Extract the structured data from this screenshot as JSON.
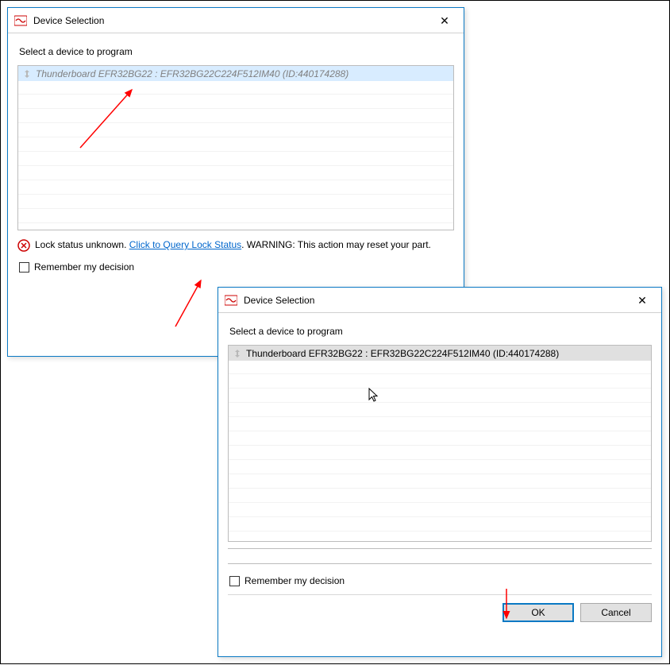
{
  "dialog1": {
    "title": "Device Selection",
    "prompt": "Select a device to program",
    "device_row": "Thunderboard EFR32BG22 : EFR32BG22C224F512IM40 (ID:440174288)",
    "status_prefix": "Lock status unknown. ",
    "status_link": "Click to Query Lock Status",
    "status_suffix": ".  WARNING: This action may reset your part.",
    "remember_label": "Remember my decision"
  },
  "dialog2": {
    "title": "Device Selection",
    "prompt": "Select a device to program",
    "device_row": "Thunderboard EFR32BG22 : EFR32BG22C224F512IM40 (ID:440174288)",
    "remember_label": "Remember my decision",
    "ok_label": "OK",
    "cancel_label": "Cancel",
    "filter_value": ""
  }
}
